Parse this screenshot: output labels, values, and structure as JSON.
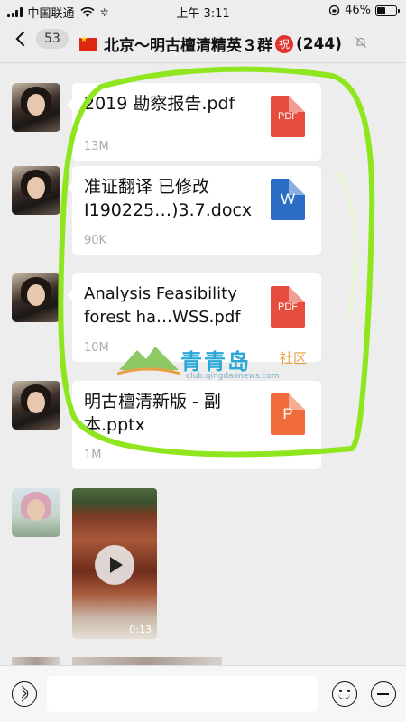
{
  "status_bar": {
    "carrier": "中国联通",
    "time": "上午 3:11",
    "battery_percent": "46%",
    "battery_level": 0.46
  },
  "nav": {
    "unread_count": "53",
    "title": "北京～明古檀清精英３群",
    "title_badge": "祝",
    "member_count": "(244)"
  },
  "messages": [
    {
      "file_name": "2019 勘察报告.pdf",
      "file_size": "13M",
      "file_type": "PDF",
      "icon": "pdf-icon"
    },
    {
      "file_name": "准证翻译 已修改 I190225…)3.7.docx",
      "file_size": "90K",
      "file_type": "W",
      "icon": "word-icon"
    },
    {
      "file_name": "Analysis Feasibility forest ha…WSS.pdf",
      "file_size": "10M",
      "file_type": "PDF",
      "icon": "pdf-icon"
    },
    {
      "file_name": "明古檀清新版 - 副本.pptx",
      "file_size": "1M",
      "file_type": "P",
      "icon": "ppt-icon"
    }
  ],
  "video": {
    "duration": "0:13",
    "icon": "play-icon"
  },
  "watermark": {
    "name": "青青岛",
    "suffix": "社区",
    "url": "club.qingdaonews.com"
  },
  "colors": {
    "highlight": "#8fe61f",
    "pdf": "#e74c3c",
    "word": "#2b6cc4",
    "ppt": "#ef6b39"
  }
}
